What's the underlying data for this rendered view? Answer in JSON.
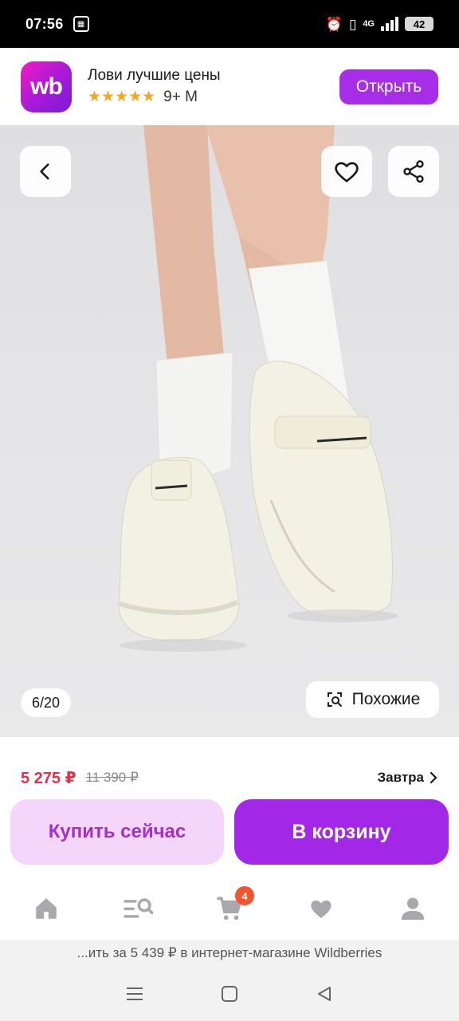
{
  "status_bar": {
    "time": "07:56",
    "network": "4G",
    "battery": "42"
  },
  "app_banner": {
    "title": "Лови лучшие цены",
    "stars": "★★★★★",
    "age_rating": "9+ M",
    "open_label": "Открыть",
    "logo_text": "wb"
  },
  "product_image": {
    "counter": "6/20",
    "similar_label": "Похожие"
  },
  "pricing": {
    "current_price": "5 275 ₽",
    "old_price": "11 390 ₽",
    "delivery_label": "Завтра"
  },
  "actions": {
    "buy_now_label": "Купить сейчас",
    "add_to_cart_label": "В корзину"
  },
  "tab_bar": {
    "cart_badge": "4"
  },
  "url_bar": {
    "text": "...ить за 5 439 ₽ в интернет-магазине Wildberries"
  },
  "colors": {
    "brand_purple": "#a227e6",
    "price_red": "#e2324a",
    "badge_orange": "#f4532b"
  }
}
